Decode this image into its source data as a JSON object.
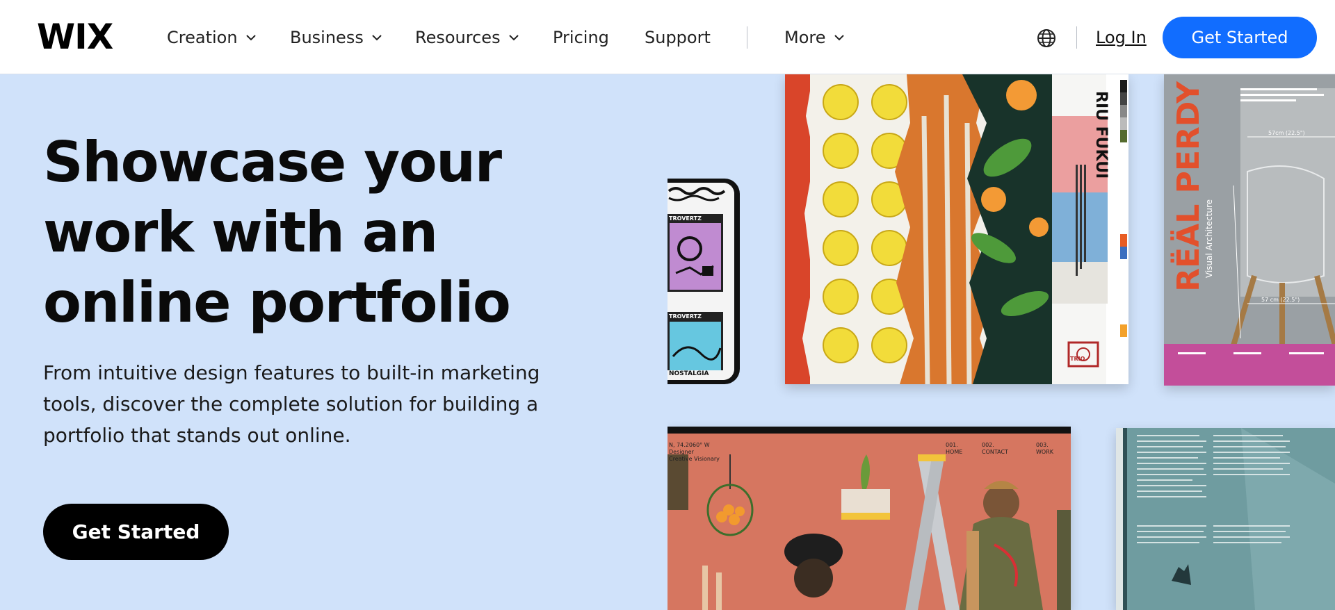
{
  "brand": {
    "logo": "WIX"
  },
  "nav": {
    "items": [
      {
        "label": "Creation",
        "dropdown": true
      },
      {
        "label": "Business",
        "dropdown": true
      },
      {
        "label": "Resources",
        "dropdown": true
      },
      {
        "label": "Pricing",
        "dropdown": false
      },
      {
        "label": "Support",
        "dropdown": false
      },
      {
        "label": "More",
        "dropdown": true
      }
    ],
    "login": "Log In",
    "cta": "Get Started"
  },
  "hero": {
    "headline_1": "Showcase your",
    "headline_2": "work with an",
    "headline_3": "online portfolio",
    "subtext": "From intuitive design features to built-in marketing tools, discover the complete solution for building a portfolio that stands out online.",
    "cta": "Get Started"
  },
  "gallery": {
    "poster_title": "RIU FUKUI",
    "poster_logo": "TRIO",
    "real_perdy_title": "RËÄL PERDY",
    "real_perdy_sub": "Visual Architecture",
    "real_perdy_dims": [
      "57cm (22.5\")",
      "57 cm (22.5\")"
    ],
    "site_nav": [
      "001. HOME",
      "002. CONTACT",
      "003. WORK"
    ],
    "site_caption": [
      "N, 74.2060° W",
      "Designer",
      "Creative Visionary"
    ],
    "phone_mag": [
      "TROVERTZ",
      "TROVERTZ",
      "NOSTALGIA"
    ]
  },
  "colors": {
    "hero_bg": "#d0e2fa",
    "brand_blue": "#116dff",
    "cta_black": "#000000"
  }
}
